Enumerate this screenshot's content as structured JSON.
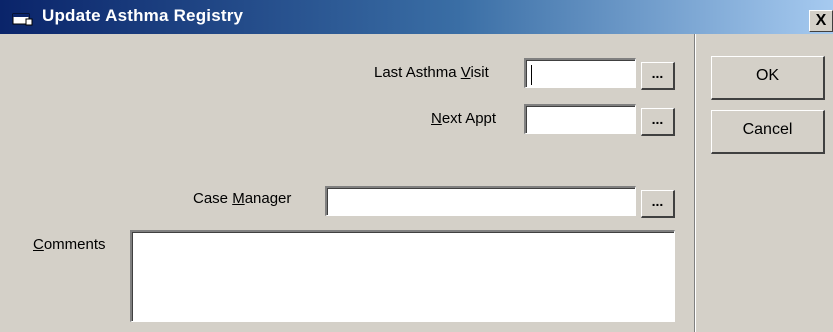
{
  "window": {
    "title": "Update Asthma Registry",
    "close_label": "X"
  },
  "form": {
    "last_visit": {
      "label_pre": "Last Asthma ",
      "label_key": "V",
      "label_post": "isit",
      "value": ""
    },
    "next_appt": {
      "label_pre": "",
      "label_key": "N",
      "label_post": "ext Appt",
      "value": ""
    },
    "case_manager": {
      "label_pre": "Case ",
      "label_key": "M",
      "label_post": "anager",
      "value": ""
    },
    "comments": {
      "label_pre": "",
      "label_key": "C",
      "label_post": "omments",
      "value": ""
    },
    "browse_label": "..."
  },
  "buttons": {
    "ok": "OK",
    "cancel": "Cancel"
  },
  "icons": {
    "title": "app-window-icon",
    "close": "close-icon"
  },
  "colors": {
    "title_gradient_start": "#0a246a",
    "title_gradient_end": "#a6caf0",
    "face": "#d4d0c8"
  }
}
